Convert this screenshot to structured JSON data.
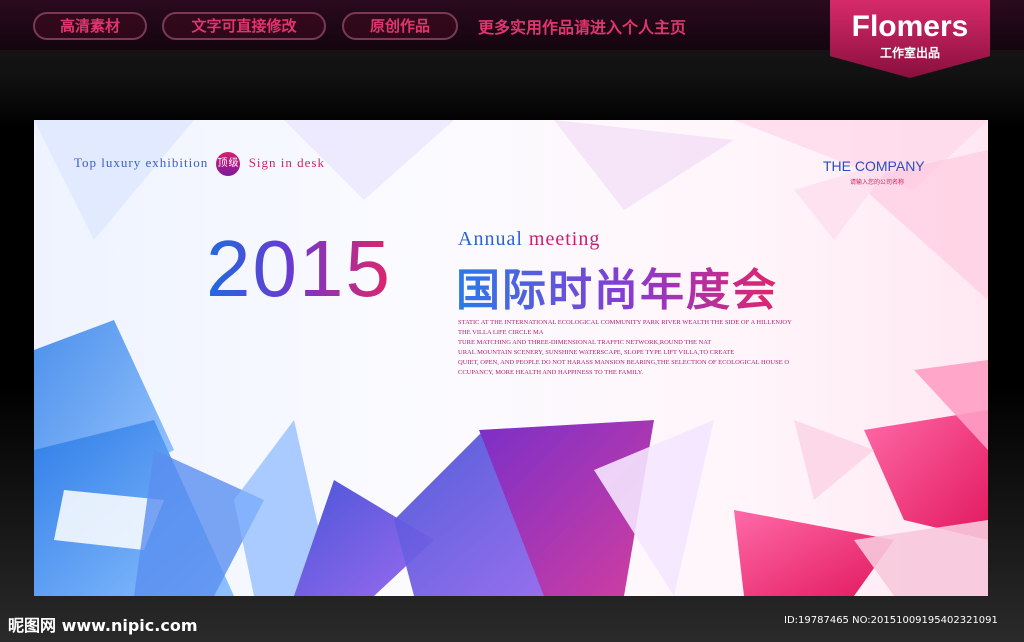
{
  "top_bar": {
    "pills": [
      "高清素材",
      "文字可直接修改",
      "原创作品"
    ],
    "promo": "更多实用作品请进入个人主页"
  },
  "badge": {
    "title": "Flomers",
    "subtitle": "工作室出品"
  },
  "poster": {
    "tagline_pre": "Top luxury exhibition",
    "tagline_badge": "顶级",
    "tagline_post": "Sign in desk",
    "company": "THE COMPANY",
    "company_sub": "请输入您的公司名称",
    "year": "2015",
    "annual_a": "Annual",
    "annual_b": "meeting",
    "cn_title": "国际时尚年度会",
    "paragraph": [
      "STATIC AT THE INTERNATIONAL ECOLOGICAL COMMUNITY PARK RIVER WEALTH THE SIDE OF A HILLENJOY",
      "THE VILLA LIFE CIRCLE MA",
      "TURE MATCHING AND THREE-DIMENSIONAL TRAFFIC NETWORK,ROUND THE NAT",
      "URAL MOUNTAIN SCENERY, SUNSHINE WATERSCAPE, SLOPE TYPE LIFT VILLA,TO CREATE",
      "QUIET, OPEN, AND PEOPLE DO NOT HARASS MANSION BEARING,THE SELECTION OF ECOLOGICAL HOUSE O",
      "CCUPANCY, MORE HEALTH AND HAPPINESS TO THE FAMILY."
    ]
  },
  "watermark": {
    "left": "昵图网 www.nipic.com",
    "right": "ID:19787465 NO:20151009195402321091"
  },
  "colors": {
    "accent_pink": "#e0356e",
    "accent_blue": "#2a63d6",
    "accent_purple": "#8a3ad0"
  }
}
